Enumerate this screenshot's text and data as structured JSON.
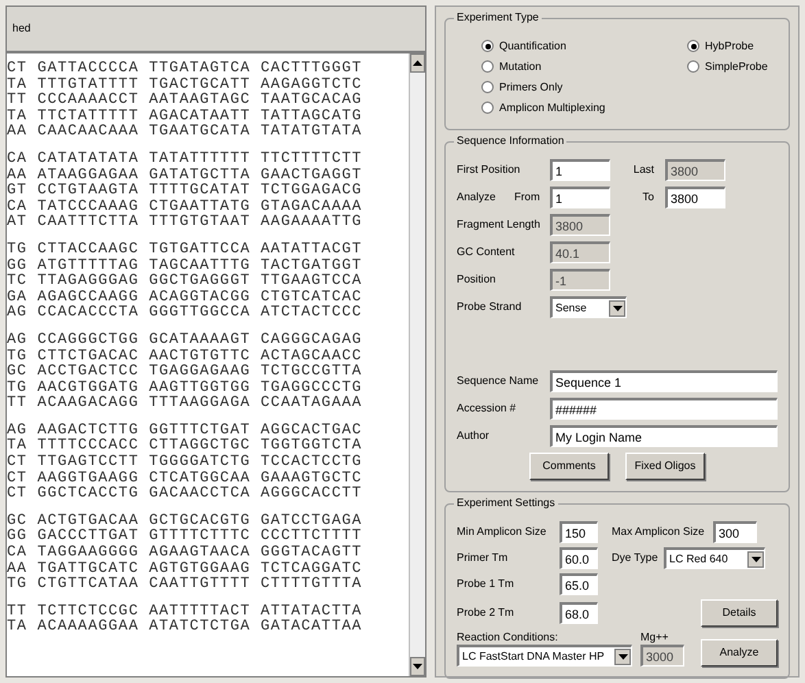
{
  "sequence_panel": {
    "title": "hed",
    "blocks": [
      [
        "CT GATTACCCCA TTGATAGTCA CACTTTGGGT",
        "TA TTTGTATTTT TGACTGCATT AAGAGGTCTC",
        "TT CCCAAAACCT AATAAGTAGC TAATGCACAG",
        "TA TTCTATTTTT AGACATAATT TATTAGCATG",
        "AA CAACAACAAA TGAATGCATA TATATGTATA"
      ],
      [
        "CA CATATATATA TATATTTTTT TTCTTTTCTT",
        "AA ATAAGGAGAA GATATGCTTA GAACTGAGGT",
        "GT CCTGTAAGTA TTTTGCATAT TCTGGAGACG",
        "CA TATCCCAAAG CTGAATTATG GTAGACAAAA",
        "AT CAATTTCTTA TTTGTGTAAT AAGAAAATTG"
      ],
      [
        "TG CTTACCAAGC TGTGATTCCA AATATTACGT",
        "GG ATGTTTTTAG TAGCAATTTG TACTGATGGT",
        "TC TTAGAGGGAG GGCTGAGGGT TTGAAGTCCA",
        "GA AGAGCCAAGG ACAGGTACGG CTGTCATCAC",
        "AG CCACACCCTA GGGTTGGCCA ATCTACTCCC"
      ],
      [
        "AG CCAGGGCTGG GCATAAAAGT CAGGGCAGAG",
        "TG CTTCTGACAC AACTGTGTTC ACTAGCAACC",
        "GC ACCTGACTCC TGAGGAGAAG TCTGCCGTTA",
        "TG AACGTGGATG AAGTTGGTGG TGAGGCCCTG",
        "TT ACAAGACAGG TTTAAGGAGA CCAATAGAAA"
      ],
      [
        "AG AAGACTCTTG GGTTTCTGAT AGGCACTGAC",
        "TA TTTTCCCACC CTTAGGCTGC TGGTGGTCTA",
        "CT TTGAGTCCTT TGGGGATCTG TCCACTCCTG",
        "CT AAGGTGAAGG CTCATGGCAA GAAAGTGCTC",
        "CT GGCTCACCTG GACAACCTCA AGGGCACCTT"
      ],
      [
        "GC ACTGTGACAA GCTGCACGTG GATCCTGAGA",
        "GG GACCCTTGAT GTTTTCTTTC CCCTTCTTTT",
        "CA TAGGAAGGGG AGAAGTAACA GGGTACAGTT",
        "AA TGATTGCATC AGTGTGGAAG TCTCAGGATC",
        "TG CTGTTCATAA CAATTGTTTT CTTTTGTTTA"
      ],
      [
        "TT TCTTCTCCGC AATTTTTACT ATTATACTTA",
        "TA ACAAAAGGAA ATATCTCTGA GATACATTAA"
      ]
    ]
  },
  "experiment_type": {
    "title": "Experiment Type",
    "assay_options": [
      {
        "label": "Quantification",
        "selected": true
      },
      {
        "label": "Mutation",
        "selected": false
      },
      {
        "label": "Primers Only",
        "selected": false
      },
      {
        "label": "Amplicon Multiplexing",
        "selected": false
      }
    ],
    "probe_options": [
      {
        "label": "HybProbe",
        "selected": true
      },
      {
        "label": "SimpleProbe",
        "selected": false
      }
    ]
  },
  "sequence_information": {
    "title": "Sequence Information",
    "first_position": {
      "label": "First Position",
      "value": "1"
    },
    "last": {
      "label": "Last",
      "value": "3800",
      "disabled": true
    },
    "analyze_label": "Analyze",
    "from": {
      "label": "From",
      "value": "1"
    },
    "to": {
      "label": "To",
      "value": "3800"
    },
    "fragment_length": {
      "label": "Fragment Length",
      "value": "3800",
      "disabled": true
    },
    "gc_content": {
      "label": "GC Content",
      "value": "40.1",
      "disabled": true
    },
    "position": {
      "label": "Position",
      "value": "-1",
      "disabled": true
    },
    "probe_strand": {
      "label": "Probe Strand",
      "value": "Sense"
    },
    "sequence_name": {
      "label": "Sequence Name",
      "value": "Sequence 1"
    },
    "accession": {
      "label": "Accession #",
      "value": "######"
    },
    "author": {
      "label": "Author",
      "value": "My Login Name"
    },
    "buttons": [
      "Comments",
      "Fixed Oligos"
    ]
  },
  "experiment_settings": {
    "title": "Experiment Settings",
    "min_amplicon_size": {
      "label": "Min Amplicon Size",
      "value": "150"
    },
    "max_amplicon_size": {
      "label": "Max Amplicon Size",
      "value": "300"
    },
    "primer_tm": {
      "label": "Primer Tm",
      "value": "60.0"
    },
    "dye_type": {
      "label": "Dye Type",
      "value": "LC Red 640"
    },
    "probe_1_tm": {
      "label": "Probe 1 Tm",
      "value": "65.0"
    },
    "probe_2_tm": {
      "label": "Probe 2 Tm",
      "value": "68.0"
    },
    "reaction_conditions": {
      "label": "Reaction Conditions:",
      "value": "LC FastStart DNA Master HP"
    },
    "mg": {
      "label": "Mg++",
      "value": "3000",
      "disabled": true
    },
    "buttons": [
      "Details",
      "Analyze"
    ]
  }
}
